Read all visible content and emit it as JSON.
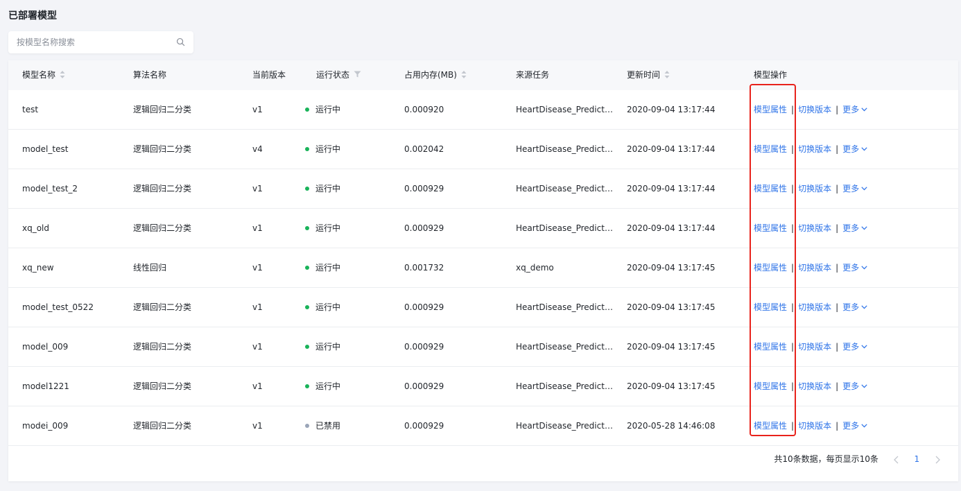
{
  "page": {
    "title": "已部署模型"
  },
  "search": {
    "placeholder": "按模型名称搜索",
    "icon": "search-icon"
  },
  "table": {
    "columns": [
      {
        "key": "name",
        "label": "模型名称",
        "sortable": true
      },
      {
        "key": "algorithm",
        "label": "算法名称"
      },
      {
        "key": "version",
        "label": "当前版本"
      },
      {
        "key": "status",
        "label": "运行状态",
        "filterable": true
      },
      {
        "key": "memory",
        "label": "占用内存(MB)",
        "sortable": true
      },
      {
        "key": "source_task",
        "label": "来源任务"
      },
      {
        "key": "updated_at",
        "label": "更新时间",
        "sortable": true
      },
      {
        "key": "actions",
        "label": "模型操作"
      }
    ],
    "rows": [
      {
        "name": "test",
        "algorithm": "逻辑回归二分类",
        "version": "v1",
        "status": "运行中",
        "status_color": "#19b35a",
        "memory": "0.000920",
        "source_task": "HeartDisease_Prediction",
        "updated_at": "2020-09-04 13:17:44"
      },
      {
        "name": "model_test",
        "algorithm": "逻辑回归二分类",
        "version": "v4",
        "status": "运行中",
        "status_color": "#19b35a",
        "memory": "0.002042",
        "source_task": "HeartDisease_Prediction",
        "updated_at": "2020-09-04 13:17:44"
      },
      {
        "name": "model_test_2",
        "algorithm": "逻辑回归二分类",
        "version": "v1",
        "status": "运行中",
        "status_color": "#19b35a",
        "memory": "0.000929",
        "source_task": "HeartDisease_Predictio…",
        "updated_at": "2020-09-04 13:17:44"
      },
      {
        "name": "xq_old",
        "algorithm": "逻辑回归二分类",
        "version": "v1",
        "status": "运行中",
        "status_color": "#19b35a",
        "memory": "0.000929",
        "source_task": "HeartDisease_Prediction",
        "updated_at": "2020-09-04 13:17:44"
      },
      {
        "name": "xq_new",
        "algorithm": "线性回归",
        "version": "v1",
        "status": "运行中",
        "status_color": "#19b35a",
        "memory": "0.001732",
        "source_task": "xq_demo",
        "updated_at": "2020-09-04 13:17:45"
      },
      {
        "name": "model_test_0522",
        "algorithm": "逻辑回归二分类",
        "version": "v1",
        "status": "运行中",
        "status_color": "#19b35a",
        "memory": "0.000929",
        "source_task": "HeartDisease_Prediction",
        "updated_at": "2020-09-04 13:17:45"
      },
      {
        "name": "model_009",
        "algorithm": "逻辑回归二分类",
        "version": "v1",
        "status": "运行中",
        "status_color": "#19b35a",
        "memory": "0.000929",
        "source_task": "HeartDisease_Prediction",
        "updated_at": "2020-09-04 13:17:45"
      },
      {
        "name": "model1221",
        "algorithm": "逻辑回归二分类",
        "version": "v1",
        "status": "运行中",
        "status_color": "#19b35a",
        "memory": "0.000929",
        "source_task": "HeartDisease_Prediction",
        "updated_at": "2020-09-04 13:17:45"
      },
      {
        "name": "modei_009",
        "algorithm": "逻辑回归二分类",
        "version": "v1",
        "status": "已禁用",
        "status_color": "#9aa5b8",
        "memory": "0.000929",
        "source_task": "HeartDisease_Prediction",
        "updated_at": "2020-05-28 14:46:08"
      }
    ],
    "row_actions": {
      "properties": "模型属性",
      "switch_version": "切换版本",
      "more": "更多",
      "separator": "|"
    }
  },
  "pagination": {
    "summary": "共10条数据，每页显示10条",
    "current_page": "1"
  },
  "colors": {
    "link": "#2f74e8",
    "running": "#19b35a",
    "disabled": "#9aa5b8",
    "highlight_box": "#e8221b"
  }
}
